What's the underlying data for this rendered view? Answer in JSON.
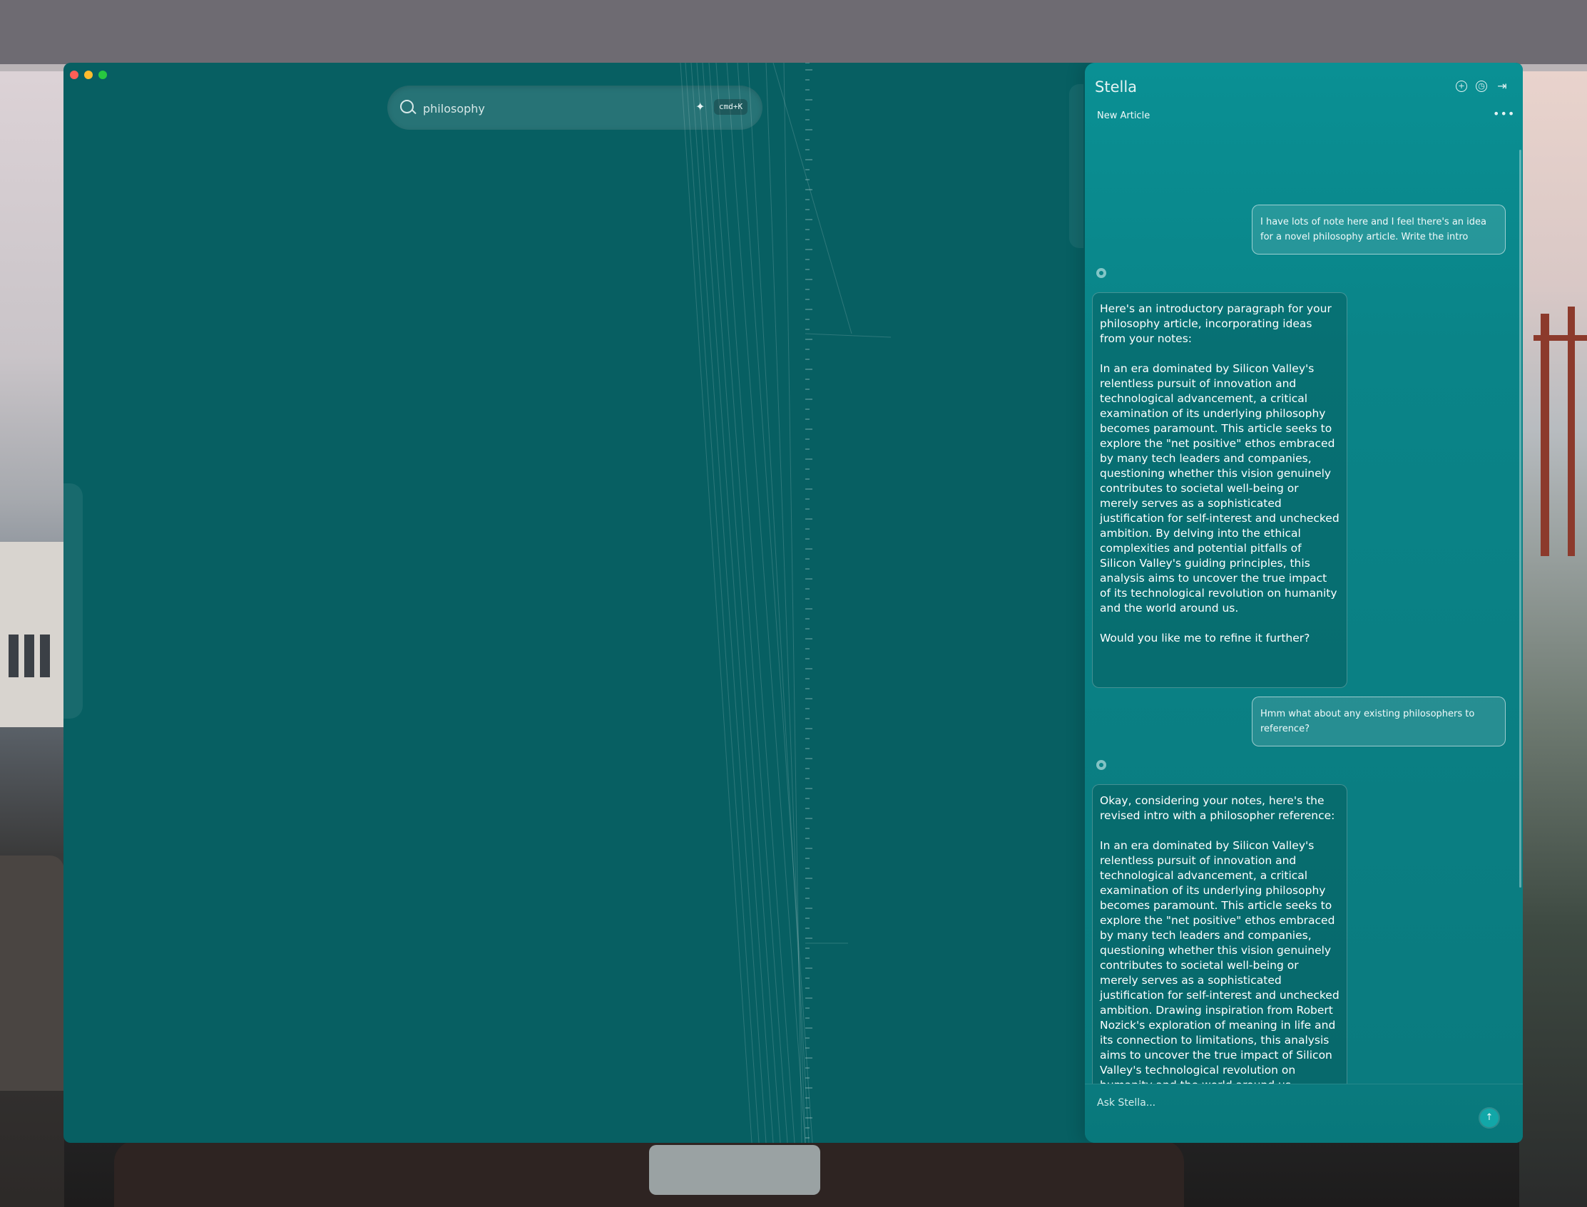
{
  "search": {
    "query": "philosophy",
    "shortcut": "cmd+K"
  },
  "panel": {
    "title": "Stella",
    "document_title": "New Article"
  },
  "messages": [
    {
      "role": "user",
      "text": "I have lots of note here and I feel there's an idea for a novel philosophy article. Write the intro"
    },
    {
      "role": "assistant",
      "paragraphs": [
        "Here's an introductory paragraph for your philosophy article, incorporating ideas from your notes:",
        "In an era dominated by Silicon Valley's relentless pursuit of innovation and technological advancement, a critical examination of its underlying philosophy becomes paramount. This article seeks to explore the \"net positive\" ethos embraced by many tech leaders and companies, questioning whether this vision genuinely contributes to societal well-being or merely serves as a sophisticated justification for self-interest and unchecked ambition. By delving into the ethical complexities and potential pitfalls of Silicon Valley's guiding principles, this analysis aims to uncover the true impact of its technological revolution on humanity and the world around us.",
        "Would you like me to refine it further?"
      ]
    },
    {
      "role": "user",
      "text": "Hmm what about any existing philosophers to reference?"
    },
    {
      "role": "assistant",
      "paragraphs": [
        "Okay, considering your notes, here's the revised intro with a philosopher reference:",
        "In an era dominated by Silicon Valley's relentless pursuit of innovation and technological advancement, a critical examination of its underlying philosophy becomes paramount. This article seeks to explore the \"net positive\" ethos embraced by many tech leaders and companies, questioning whether this vision genuinely contributes to societal well-being or merely serves as a sophisticated justification for self-interest and unchecked ambition. Drawing inspiration from Robert Nozick's exploration of meaning in life and its connection to limitations, this analysis aims to uncover the true impact of Silicon Valley's technological revolution on humanity and the world around us, probing whether this \"net positive\""
      ]
    }
  ],
  "composer": {
    "placeholder": "Ask Stella..."
  },
  "icons": {
    "search": "search-icon",
    "sparkle": "sparkle-icon",
    "new_chat": "plus-circle-icon",
    "history": "clock-icon",
    "collapse": "collapse-right-icon",
    "more": "more-horizontal-icon",
    "send": "arrow-up-icon"
  },
  "colors": {
    "canvas": "#075f62",
    "panel": "#0a8488",
    "accent": "#12a7a8"
  }
}
